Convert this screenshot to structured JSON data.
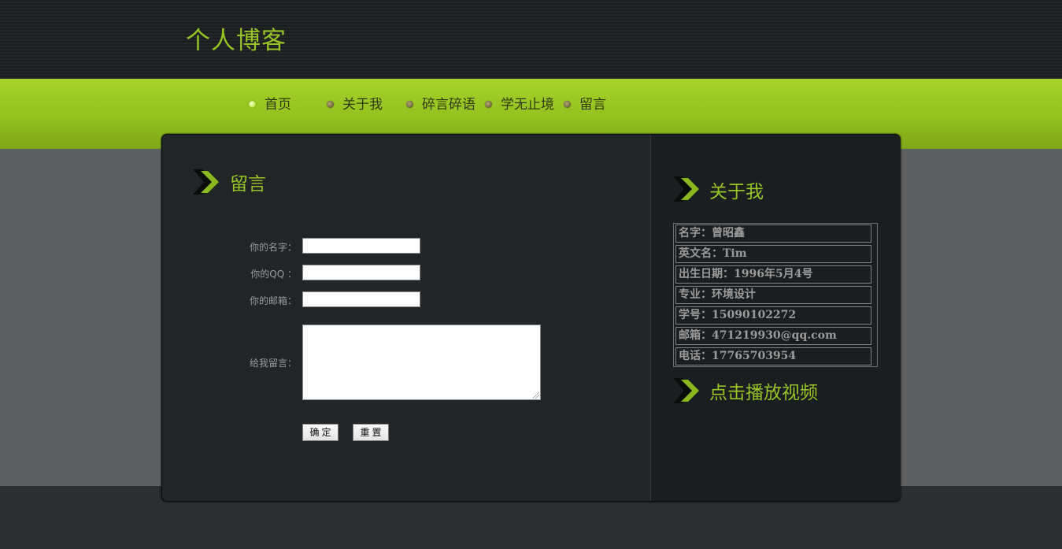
{
  "header": {
    "site_title": "个人博客"
  },
  "nav": {
    "items": [
      {
        "label": "首页",
        "active": true
      },
      {
        "label": "关于我",
        "active": false
      },
      {
        "label": "碎言碎语",
        "active": false
      },
      {
        "label": "学无止境",
        "active": false
      },
      {
        "label": "留言",
        "active": false
      }
    ]
  },
  "main": {
    "title": "留言",
    "form": {
      "name_label": "你的名字：",
      "qq_label": "你的QQ ：",
      "email_label": "你的邮箱：",
      "message_label": "给我留言：",
      "name_value": "",
      "qq_value": "",
      "email_value": "",
      "message_value": "",
      "submit_label": "确定",
      "reset_label": "重置"
    }
  },
  "sidebar": {
    "about_title": "关于我",
    "info": [
      "名字：曾昭鑫",
      "英文名：Tim",
      "出生日期：1996年5月4号",
      "专业：环境设计",
      "学号：15090102272",
      "邮箱：471219930@qq.com",
      "电话：17765703954"
    ],
    "video_title": "点击播放视频"
  },
  "colors": {
    "accent_green": "#97c424",
    "nav_band": "#93c11f",
    "panel_bg": "#212528",
    "sidebar_bg": "#1b1e20"
  }
}
